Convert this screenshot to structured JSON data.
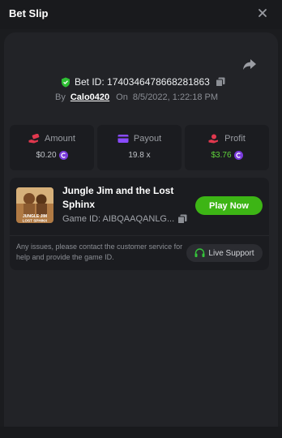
{
  "header": {
    "title": "Bet Slip"
  },
  "bet": {
    "id_text": "Bet ID: 1740346478668281863",
    "by_label": "By",
    "username": "Calo0420",
    "on_label": "On",
    "datetime": "8/5/2022, 1:22:18 PM"
  },
  "stats": [
    {
      "label": "Amount",
      "value": "$0.20",
      "icon": "money-hand-icon",
      "has_coin": true
    },
    {
      "label": "Payout",
      "value": "19.8 x",
      "icon": "card-icon",
      "has_coin": false
    },
    {
      "label": "Profit",
      "value": "$3.76",
      "icon": "profit-hand-icon",
      "has_coin": true
    }
  ],
  "game": {
    "title": "Jungle Jim and the Lost Sphinx",
    "game_id": "Game ID: AIBQAAQANLG...",
    "play_label": "Play Now",
    "thumb_caption": "JUNGLE JIM and the LOST SPHINX",
    "support_text": "Any issues, please contact the customer service for help and provide the game ID.",
    "live_support_label": "Live Support"
  },
  "colors": {
    "accent_green": "#3db515",
    "profit_green": "#5fd33a",
    "coin_purple": "#7a3bdc",
    "amount_red": "#e0384e",
    "payout_purple": "#8a4bff"
  }
}
